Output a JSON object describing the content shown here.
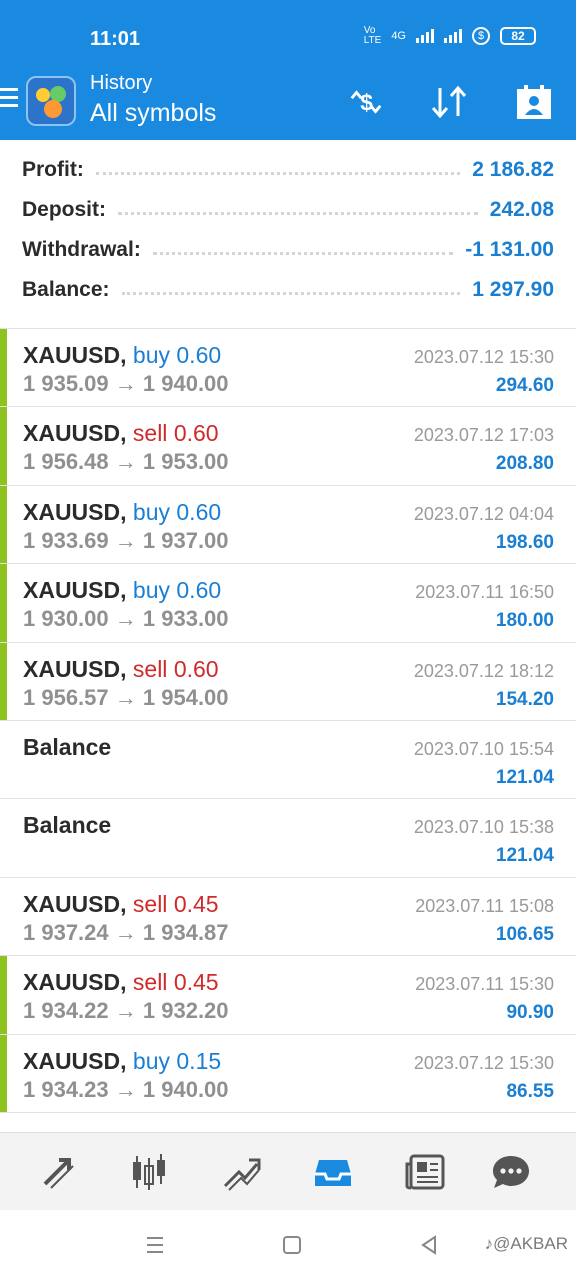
{
  "status_bar": {
    "time": "11:01",
    "network_label": "4G",
    "battery": "82"
  },
  "app_bar": {
    "subtitle": "History",
    "title": "All symbols",
    "icons": [
      "menu-icon",
      "metatrader-logo",
      "currency-swap-icon",
      "sort-icon",
      "calendar-icon"
    ]
  },
  "summary": [
    {
      "label": "Profit:",
      "value": "2 186.82"
    },
    {
      "label": "Deposit:",
      "value": "242.08"
    },
    {
      "label": "Withdrawal:",
      "value": "-1 131.00"
    },
    {
      "label": "Balance:",
      "value": "1 297.90"
    }
  ],
  "deals": [
    {
      "kind": "trade",
      "symbol": "XAUUSD,",
      "side": "buy",
      "volume": "0.60",
      "open": "1 935.09",
      "close": "1 940.00",
      "time": "2023.07.12 15:30",
      "profit": "294.60",
      "marker": true
    },
    {
      "kind": "trade",
      "symbol": "XAUUSD,",
      "side": "sell",
      "volume": "0.60",
      "open": "1 956.48",
      "close": "1 953.00",
      "time": "2023.07.12 17:03",
      "profit": "208.80",
      "marker": true
    },
    {
      "kind": "trade",
      "symbol": "XAUUSD,",
      "side": "buy",
      "volume": "0.60",
      "open": "1 933.69",
      "close": "1 937.00",
      "time": "2023.07.12 04:04",
      "profit": "198.60",
      "marker": true
    },
    {
      "kind": "trade",
      "symbol": "XAUUSD,",
      "side": "buy",
      "volume": "0.60",
      "open": "1 930.00",
      "close": "1 933.00",
      "time": "2023.07.11 16:50",
      "profit": "180.00",
      "marker": true
    },
    {
      "kind": "trade",
      "symbol": "XAUUSD,",
      "side": "sell",
      "volume": "0.60",
      "open": "1 956.57",
      "close": "1 954.00",
      "time": "2023.07.12 18:12",
      "profit": "154.20",
      "marker": true
    },
    {
      "kind": "balance",
      "label": "Balance",
      "time": "2023.07.10 15:54",
      "profit": "121.04",
      "marker": false
    },
    {
      "kind": "balance",
      "label": "Balance",
      "time": "2023.07.10 15:38",
      "profit": "121.04",
      "marker": false
    },
    {
      "kind": "trade",
      "symbol": "XAUUSD,",
      "side": "sell",
      "volume": "0.45",
      "open": "1 937.24",
      "close": "1 934.87",
      "time": "2023.07.11 15:08",
      "profit": "106.65",
      "marker": false
    },
    {
      "kind": "trade",
      "symbol": "XAUUSD,",
      "side": "sell",
      "volume": "0.45",
      "open": "1 934.22",
      "close": "1 932.20",
      "time": "2023.07.11 15:30",
      "profit": "90.90",
      "marker": true
    },
    {
      "kind": "trade",
      "symbol": "XAUUSD,",
      "side": "buy",
      "volume": "0.15",
      "open": "1 934.23",
      "close": "1 940.00",
      "time": "2023.07.12 15:30",
      "profit": "86.55",
      "marker": true
    }
  ],
  "bottom_nav": {
    "items": [
      "quotes-icon",
      "chart-icon",
      "trade-icon",
      "history-icon",
      "news-icon",
      "chat-icon"
    ],
    "active": "history-icon"
  },
  "system_nav": {
    "items": [
      "menu-icon",
      "home-icon",
      "back-icon"
    ],
    "watermark": "@AKBAR"
  },
  "colors": {
    "accent": "#1a8ae0",
    "value_blue": "#1b7fd1",
    "sell_red": "#d02a2a",
    "marker_green": "#8ec21e"
  },
  "arrow": "→"
}
